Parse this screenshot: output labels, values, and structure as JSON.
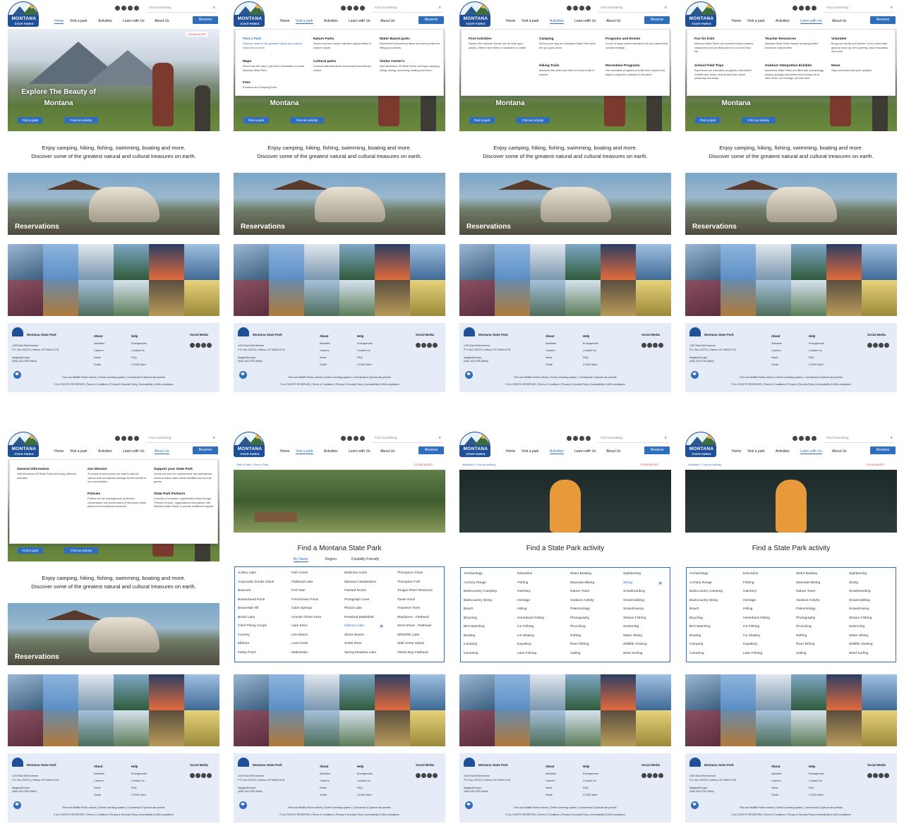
{
  "brand": {
    "line1": "MONTANA",
    "line2": "STATE PARKS"
  },
  "search": {
    "placeholder": "Find Something"
  },
  "nav": [
    "Home",
    "Visit a park",
    "Activities",
    "Learn with Us",
    "About Us"
  ],
  "reserve": "Reserve",
  "hero": {
    "title": "Explore The Beauty of Montana",
    "title_line1": "Explore The Beauty of",
    "title_line2": "Montana",
    "covid": "COVID ALERT",
    "btn_park": "Find a park",
    "btn_activity": "Find an activity"
  },
  "intro": {
    "line1": "Enjoy camping, hiking, fishing, swimming, boating and more.",
    "line2": "Discover some of the greatest natural and cultural treasures on earth."
  },
  "reservations": "Reservations",
  "footer": {
    "name": "Montana State Park",
    "address": [
      "1420 East Sixth Avenue",
      "P.O. Box 200701 | Helena, MT 59620-0701",
      "",
      "fwpgbp@mt.gov",
      "(406) 444-3750  (Main)"
    ],
    "about_title": "About",
    "about": [
      "Activities",
      "Careers",
      "News",
      "Guide"
    ],
    "help_title": "Help",
    "help": [
      "Emergencies",
      "Contact Us",
      "FAQ",
      "COVID Alert"
    ],
    "social": "Social Media",
    "links1": "Fish and Wildlife Public notices  |  Online Licensing system  |  Commercial & Special use permits",
    "links2": "© ALL RIGHTS RESERVED  |  Terms & Conditions  |  Privacy & Security Policy  |  Accessibility & ADA compliance"
  },
  "menus": {
    "visit": [
      {
        "t": "Find a Park",
        "d": "Discover some of the greatest natural and cultural treasures on earth.",
        "active": true
      },
      {
        "t": "Nature Parks",
        "d": "Scenic wonders create unlimited opportunities to explore nature."
      },
      {
        "t": "Water Based parks",
        "d": "Experience shimmering lakes and rivers perfect for filling your senses."
      },
      {
        "t": "Maps",
        "d": "Never lose the way to get more information on each Montana State Park."
      },
      {
        "t": "Cultural parks",
        "d": "Connect with Montana's storied past and diverse culture."
      },
      {
        "t": "Visitor Center's",
        "d": "Visit Montana's 55 State Parks and enjoy camping, hiking, fishing, swimming, boating and more."
      },
      {
        "t": "Fees",
        "d": "Entrance and Camping Fees"
      }
    ],
    "activities": [
      {
        "t": "Find Activities",
        "d": "Explore the outdoor! Scenic can be wide open places. Others have trees or mountains or water."
      },
      {
        "t": "Camping",
        "d": "Extend your stay at a Montana State Park when the sun goes down."
      },
      {
        "t": "Programs and Events",
        "d": "A host of many stories steeped in its rich natural and cultural heritage."
      },
      {
        "t": "Hiking Trails",
        "d": "Montana has miles and miles of scenic trails to explore"
      },
      {
        "t": "Recreation Programs",
        "d": "Our recreation programs provide more places and ways to enjoy the outdoors in Montana"
      }
    ],
    "learn": [
      {
        "t": "Fun for Kids",
        "d": "Montana State Parks are excellent indoor/outdoor classrooms and an ideal place for a school field trip."
      },
      {
        "t": "Teacher Resources",
        "d": "Montana State Parks feature amazing Native American cultural sites."
      },
      {
        "t": "Volunteer",
        "d": "Bring your family and friends. Lend a hand with general clean up, tree planting, casa restoration, and more."
      },
      {
        "t": "School Field Trips",
        "d": "Experience our education programs, interpretive exhibits and visitor centers and learn about yesterday and today."
      },
      {
        "t": "Outdoor Interpretive Exhibits",
        "d": "Montana's State Parks are filled with archaeology, botany, geology and stories that connect us to each other, our heritage, and the land."
      },
      {
        "t": "News",
        "d": "Stay connected with park updates."
      }
    ],
    "about": [
      {
        "t": "General Information",
        "d": "Visit Montana's 55 State Parks and enjoy different activities."
      },
      {
        "t": "Our Mission",
        "d": "To preserve and protect our state's cultural, natural and recreational heritage for the benefit of our communities."
      },
      {
        "t": "Support your State Park",
        "d": "Funds are used for maintenance and operational needs at these state-owned facilities and for trail grants."
      },
      {
        "t": "Policies",
        "d": "Policies for the management, protection, conservation and preservation of Montana's state parks and recreational resources."
      },
      {
        "t": "State Park Partners",
        "d": "A variety of volunteer opportunities exist through 'Friends Groups', organizations that partner with Montana State Parks to provide additional support."
      }
    ]
  },
  "parkpage": {
    "crumb": "Visit a Park > Find a Park",
    "covid": "COVID ALERT",
    "title": "Find a Montana State Park",
    "tabs": [
      "By Name",
      "Region",
      "Disability Friendly"
    ],
    "cols": [
      [
        "Ackley Lake",
        "Anaconda Smoke Stack",
        "Bannack",
        "Beaverhead Rock",
        "Beavertail Hill",
        "Brush Lake",
        "Chief Plenty Coups",
        "Cooney",
        "Elkhorn",
        "Finley Point"
      ],
      [
        "Fish Creek",
        "Flathead Lake",
        "Fort Own",
        "Frenchtown Pond",
        "Giant Springs",
        "Granite Ghost Town",
        "Lake Elmo",
        "Les Mason",
        "Lost Creek",
        "Makoshika"
      ],
      [
        "Medicine rocks",
        "Missouri Headwaters",
        "Painted Rocks",
        "Pictograph Cave",
        "Placid Lake",
        "Rosebud Battlefield",
        "Salmon Lake",
        "Sluice Boxes",
        "Smith River",
        "Spring Meadow Lake"
      ],
      [
        "Thompson Chain",
        "Thompson Fall",
        "Tongue River Reservoir",
        "Tower Rock",
        "Travelers' Rest",
        "Wayfarers - Flathead",
        "West Shore - Flathead",
        "Whitefish Lake",
        "Wild Horse Island",
        "Yellow Bay-Flathead"
      ]
    ],
    "active": "Salmon Lake"
  },
  "actpage": {
    "crumb": "Activities > Find an Activity",
    "covid": "COVID ALERT",
    "title": "Find a State Park activity",
    "cols": [
      [
        "Archaeology",
        "Archery Range",
        "Backcountry Camping",
        "Backcountry skiing",
        "Beach",
        "Bicycling",
        "Bird Watching",
        "Boating",
        "Camping",
        "Canoeing"
      ],
      [
        "Education",
        "Fishing",
        "Hatchery",
        "Heritage",
        "Hiking",
        "Horseback Riding",
        "Ice Fishing",
        "Ice Skating",
        "Kayaking",
        "Lake Fishing"
      ],
      [
        "Motor Boating",
        "Mountain Biking",
        "Nature Tours",
        "Outdoor Activity",
        "Paleontology",
        "Photography",
        "Picnicking",
        "Rafting",
        "River fishing",
        "Sailing"
      ],
      [
        "Sightseeing",
        "Skiing",
        "Snowboarding",
        "Snowmobiling",
        "Snowshoeing",
        "Stream Fishing",
        "Swimming",
        "Water Skiing",
        "Wildlife Viewing",
        "Wind Surfing"
      ]
    ],
    "active": "Skiing"
  },
  "colors": {
    "accent": "#2f6ebf",
    "brand": "#1f4f99",
    "alert": "#dd3333",
    "footer_bg": "#e6ecf7"
  }
}
